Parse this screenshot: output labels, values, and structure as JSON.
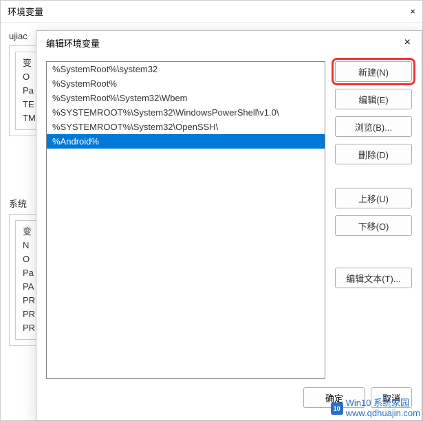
{
  "parent_window": {
    "title": "环境变量",
    "close_label": "×",
    "user_section_label": "ujiac",
    "user_vars_partial": [
      "变",
      "O",
      "Pa",
      "TE",
      "TM"
    ],
    "system_section_label": "系统",
    "system_vars_partial": [
      "变",
      "N",
      "O",
      "Pa",
      "PA",
      "PR",
      "PR",
      "PR"
    ]
  },
  "dialog": {
    "title": "编辑环境变量",
    "close_label": "×",
    "paths": [
      {
        "text": "%SystemRoot%\\system32",
        "selected": false
      },
      {
        "text": "%SystemRoot%",
        "selected": false
      },
      {
        "text": "%SystemRoot%\\System32\\Wbem",
        "selected": false
      },
      {
        "text": "%SYSTEMROOT%\\System32\\WindowsPowerShell\\v1.0\\",
        "selected": false
      },
      {
        "text": "%SYSTEMROOT%\\System32\\OpenSSH\\",
        "selected": false
      },
      {
        "text": "%Android%",
        "selected": true
      }
    ],
    "buttons": {
      "new": "新建(N)",
      "edit": "编辑(E)",
      "browse": "浏览(B)...",
      "delete": "删除(D)",
      "move_up": "上移(U)",
      "move_down": "下移(O)",
      "edit_text": "编辑文本(T)..."
    },
    "footer": {
      "ok": "确定",
      "cancel": "取消"
    }
  },
  "watermark": {
    "icon_text": "10",
    "line1": "Win10 系统家园",
    "line2": "www.qdhuajin.com"
  }
}
